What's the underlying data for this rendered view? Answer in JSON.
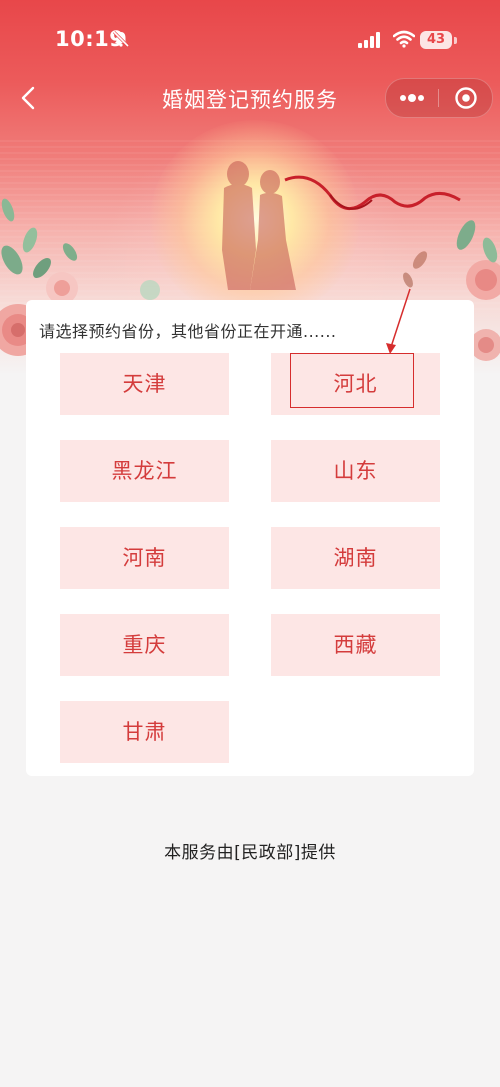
{
  "status_bar": {
    "time": "10:19",
    "battery": "43"
  },
  "nav": {
    "title": "婚姻登记预约服务"
  },
  "icons": {
    "back": "chevron-left-icon",
    "more": "more-dots-icon",
    "close": "target-close-icon",
    "mute": "bell-slash-icon",
    "signal": "signal-icon",
    "wifi": "wifi-icon"
  },
  "colors": {
    "accent": "#e8474a",
    "province_bg": "#fde6e5",
    "province_text": "#d43c3c",
    "highlight": "#d62d2d"
  },
  "prompt": "请选择预约省份，其他省份正在开通......",
  "provinces": [
    "天津",
    "河北",
    "黑龙江",
    "山东",
    "河南",
    "湖南",
    "重庆",
    "西藏",
    "甘肃"
  ],
  "footer": "本服务由[民政部]提供"
}
